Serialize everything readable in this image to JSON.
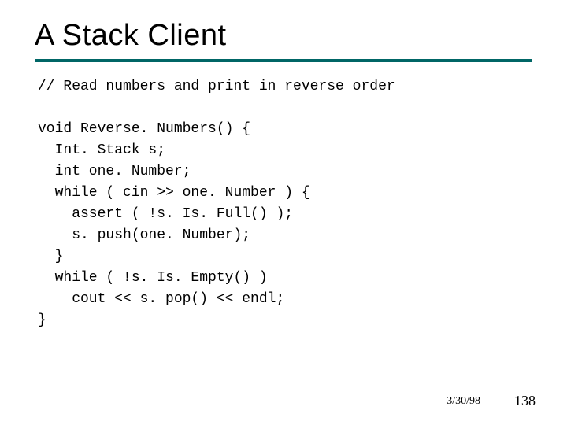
{
  "title": "A Stack Client",
  "code": "// Read numbers and print in reverse order\n\nvoid Reverse. Numbers() {\n  Int. Stack s;\n  int one. Number;\n  while ( cin >> one. Number ) {\n    assert ( !s. Is. Full() );\n    s. push(one. Number);\n  }\n  while ( !s. Is. Empty() )\n    cout << s. pop() << endl;\n}",
  "footer": {
    "date": "3/30/98",
    "page": "138"
  }
}
